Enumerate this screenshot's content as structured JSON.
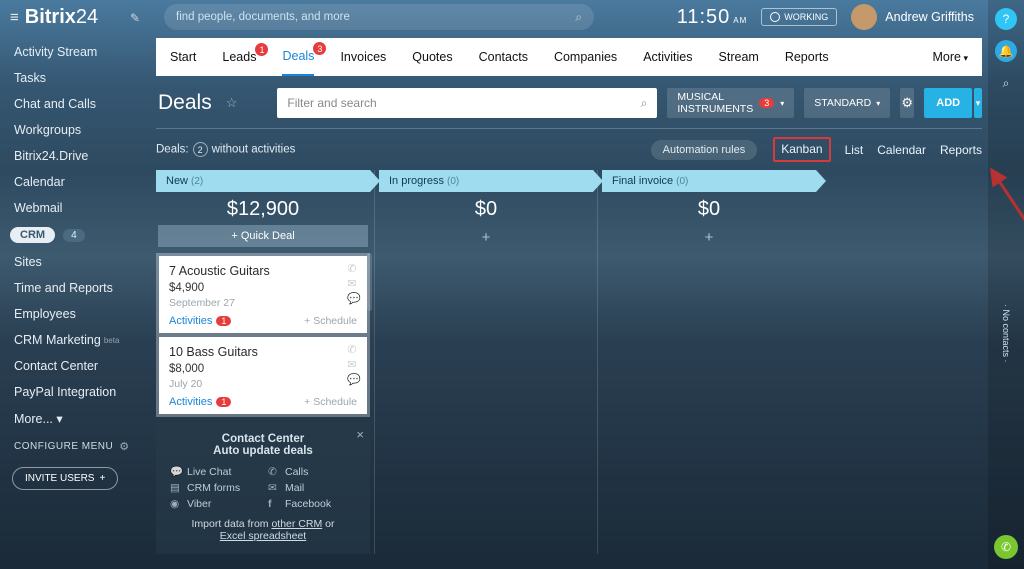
{
  "brand": {
    "name": "Bitrix",
    "suffix": "24"
  },
  "search": {
    "placeholder": "find people, documents, and more"
  },
  "clock": {
    "time": "11:50",
    "ampm": "AM"
  },
  "working": {
    "label": "WORKING"
  },
  "user": {
    "name": "Andrew Griffiths"
  },
  "nav": {
    "items": [
      {
        "label": "Activity Stream"
      },
      {
        "label": "Tasks"
      },
      {
        "label": "Chat and Calls"
      },
      {
        "label": "Workgroups"
      },
      {
        "label": "Bitrix24.Drive"
      },
      {
        "label": "Calendar"
      },
      {
        "label": "Webmail"
      },
      {
        "label": "CRM",
        "active": true,
        "badge": "4"
      },
      {
        "label": "Sites"
      },
      {
        "label": "Time and Reports"
      },
      {
        "label": "Employees"
      },
      {
        "label": "CRM Marketing",
        "beta": "beta"
      },
      {
        "label": "Contact Center"
      },
      {
        "label": "PayPal Integration"
      },
      {
        "label": "More... ▾"
      }
    ],
    "configure": "CONFIGURE MENU",
    "invite": "INVITE USERS"
  },
  "tabs": [
    {
      "label": "Start"
    },
    {
      "label": "Leads",
      "badge": "1"
    },
    {
      "label": "Deals",
      "badge": "3",
      "active": true
    },
    {
      "label": "Invoices"
    },
    {
      "label": "Quotes"
    },
    {
      "label": "Contacts"
    },
    {
      "label": "Companies"
    },
    {
      "label": "Activities"
    },
    {
      "label": "Stream"
    },
    {
      "label": "Reports"
    }
  ],
  "tabs_more": "More",
  "page": {
    "title": "Deals",
    "filter_placeholder": "Filter and search"
  },
  "toolbar": {
    "pipeline": "MUSICAL INSTRUMENTS",
    "pipeline_badge": "3",
    "standard": "STANDARD",
    "add": "ADD"
  },
  "strip": {
    "deals_lbl": "Deals:",
    "deals_cnt": "2",
    "noact": "without activities",
    "automation": "Automation rules",
    "views": [
      "Kanban",
      "List",
      "Calendar",
      "Reports"
    ],
    "active_view": 0
  },
  "columns": [
    {
      "name": "New",
      "count": "(2)",
      "sum": "$12,900",
      "quick": "+  Quick Deal",
      "cards": [
        {
          "title": "7 Acoustic Guitars",
          "amount": "$4,900",
          "date": "September 27",
          "activities": "Activities",
          "act_badge": "1",
          "schedule": "+ Schedule"
        },
        {
          "title": "10 Bass Guitars",
          "amount": "$8,000",
          "date": "July 20",
          "activities": "Activities",
          "act_badge": "1",
          "schedule": "+ Schedule"
        }
      ]
    },
    {
      "name": "In progress",
      "count": "(0)",
      "sum": "$0"
    },
    {
      "name": "Final invoice",
      "count": "(0)",
      "sum": "$0"
    }
  ],
  "promo": {
    "title": "Contact Center",
    "sub": "Auto update deals",
    "items": [
      "Live Chat",
      "Calls",
      "CRM forms",
      "Mail",
      "Viber",
      "Facebook"
    ],
    "import_pre": "Import data from ",
    "import_a": "other CRM",
    "import_mid": " or ",
    "import_b": "Excel spreadsheet"
  },
  "rail": {
    "vtext": "· No contacts ·"
  }
}
